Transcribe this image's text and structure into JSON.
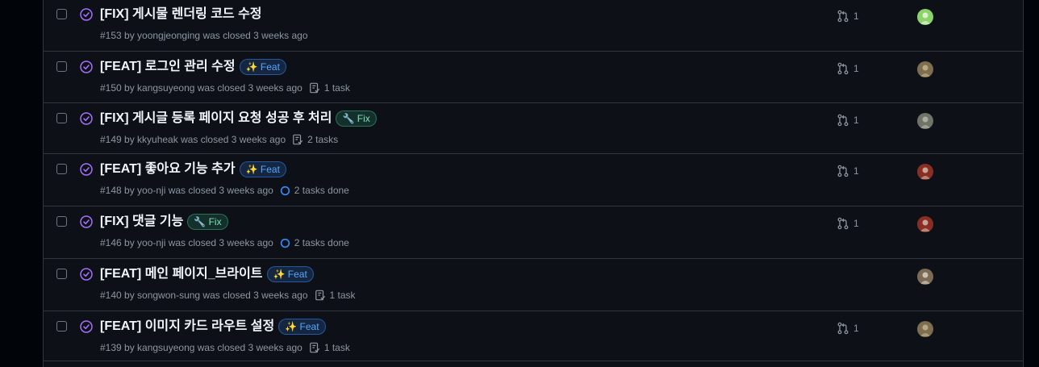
{
  "colors": {
    "closed_purple": "#a371f7",
    "muted": "#8d96a0",
    "feat_blue": "#58a6ff",
    "fix_green": "#7ee2b8"
  },
  "issues": [
    {
      "title": "[FIX] 게시물 렌더링 코드 수정",
      "label": null,
      "meta": "#153 by yoongjeonging was closed 3 weeks ago",
      "task": null,
      "task_icon": null,
      "pr_count": "1",
      "avatar_colors": [
        "#8bd46a",
        "#f2f5ee"
      ]
    },
    {
      "title": "[FEAT] 로그인 관리 수정",
      "label": "✨ Feat",
      "label_type": "feat",
      "meta": "#150 by kangsuyeong was closed 3 weeks ago",
      "task": "1 task",
      "task_icon": "tasklist-icon",
      "pr_count": "1",
      "avatar_colors": [
        "#7d6e4f",
        "#c8b98f"
      ]
    },
    {
      "title": "[FIX] 게시글 등록 페이지 요청 성공 후 처리",
      "label": "🔧 Fix",
      "label_type": "fix",
      "meta": "#149 by kkyuheak was closed 3 weeks ago",
      "task": "2 tasks",
      "task_icon": "tasklist-icon",
      "pr_count": "1",
      "avatar_colors": [
        "#6f7468",
        "#b9bcae"
      ]
    },
    {
      "title": "[FEAT] 좋아요 기능 추가",
      "label": "✨ Feat",
      "label_type": "feat",
      "meta": "#148 by yoo-nji was closed 3 weeks ago",
      "task": "2 tasks done",
      "task_icon": "progress-circle-icon",
      "pr_count": "1",
      "avatar_colors": [
        "#8a2d24",
        "#d4c3b0"
      ]
    },
    {
      "title": "[FIX] 댓글 기능",
      "label": "🔧 Fix",
      "label_type": "fix",
      "meta": "#146 by yoo-nji was closed 3 weeks ago",
      "task": "2 tasks done",
      "task_icon": "progress-circle-icon",
      "pr_count": "1",
      "avatar_colors": [
        "#8a2d24",
        "#d4c3b0"
      ]
    },
    {
      "title": "[FEAT] 메인 페이지_브라이트",
      "label": "✨ Feat",
      "label_type": "feat",
      "meta": "#140 by songwon-sung was closed 3 weeks ago",
      "task": "1 task",
      "task_icon": "tasklist-icon",
      "pr_count": null,
      "avatar_colors": [
        "#7a6a56",
        "#e0d6c8"
      ]
    },
    {
      "title": "[FEAT] 이미지 카드 라우트 설정",
      "label": "✨ Feat",
      "label_type": "feat",
      "meta": "#139 by kangsuyeong was closed 3 weeks ago",
      "task": "1 task",
      "task_icon": "tasklist-icon",
      "pr_count": "1",
      "avatar_colors": [
        "#7d6e4f",
        "#c8b98f"
      ]
    }
  ]
}
